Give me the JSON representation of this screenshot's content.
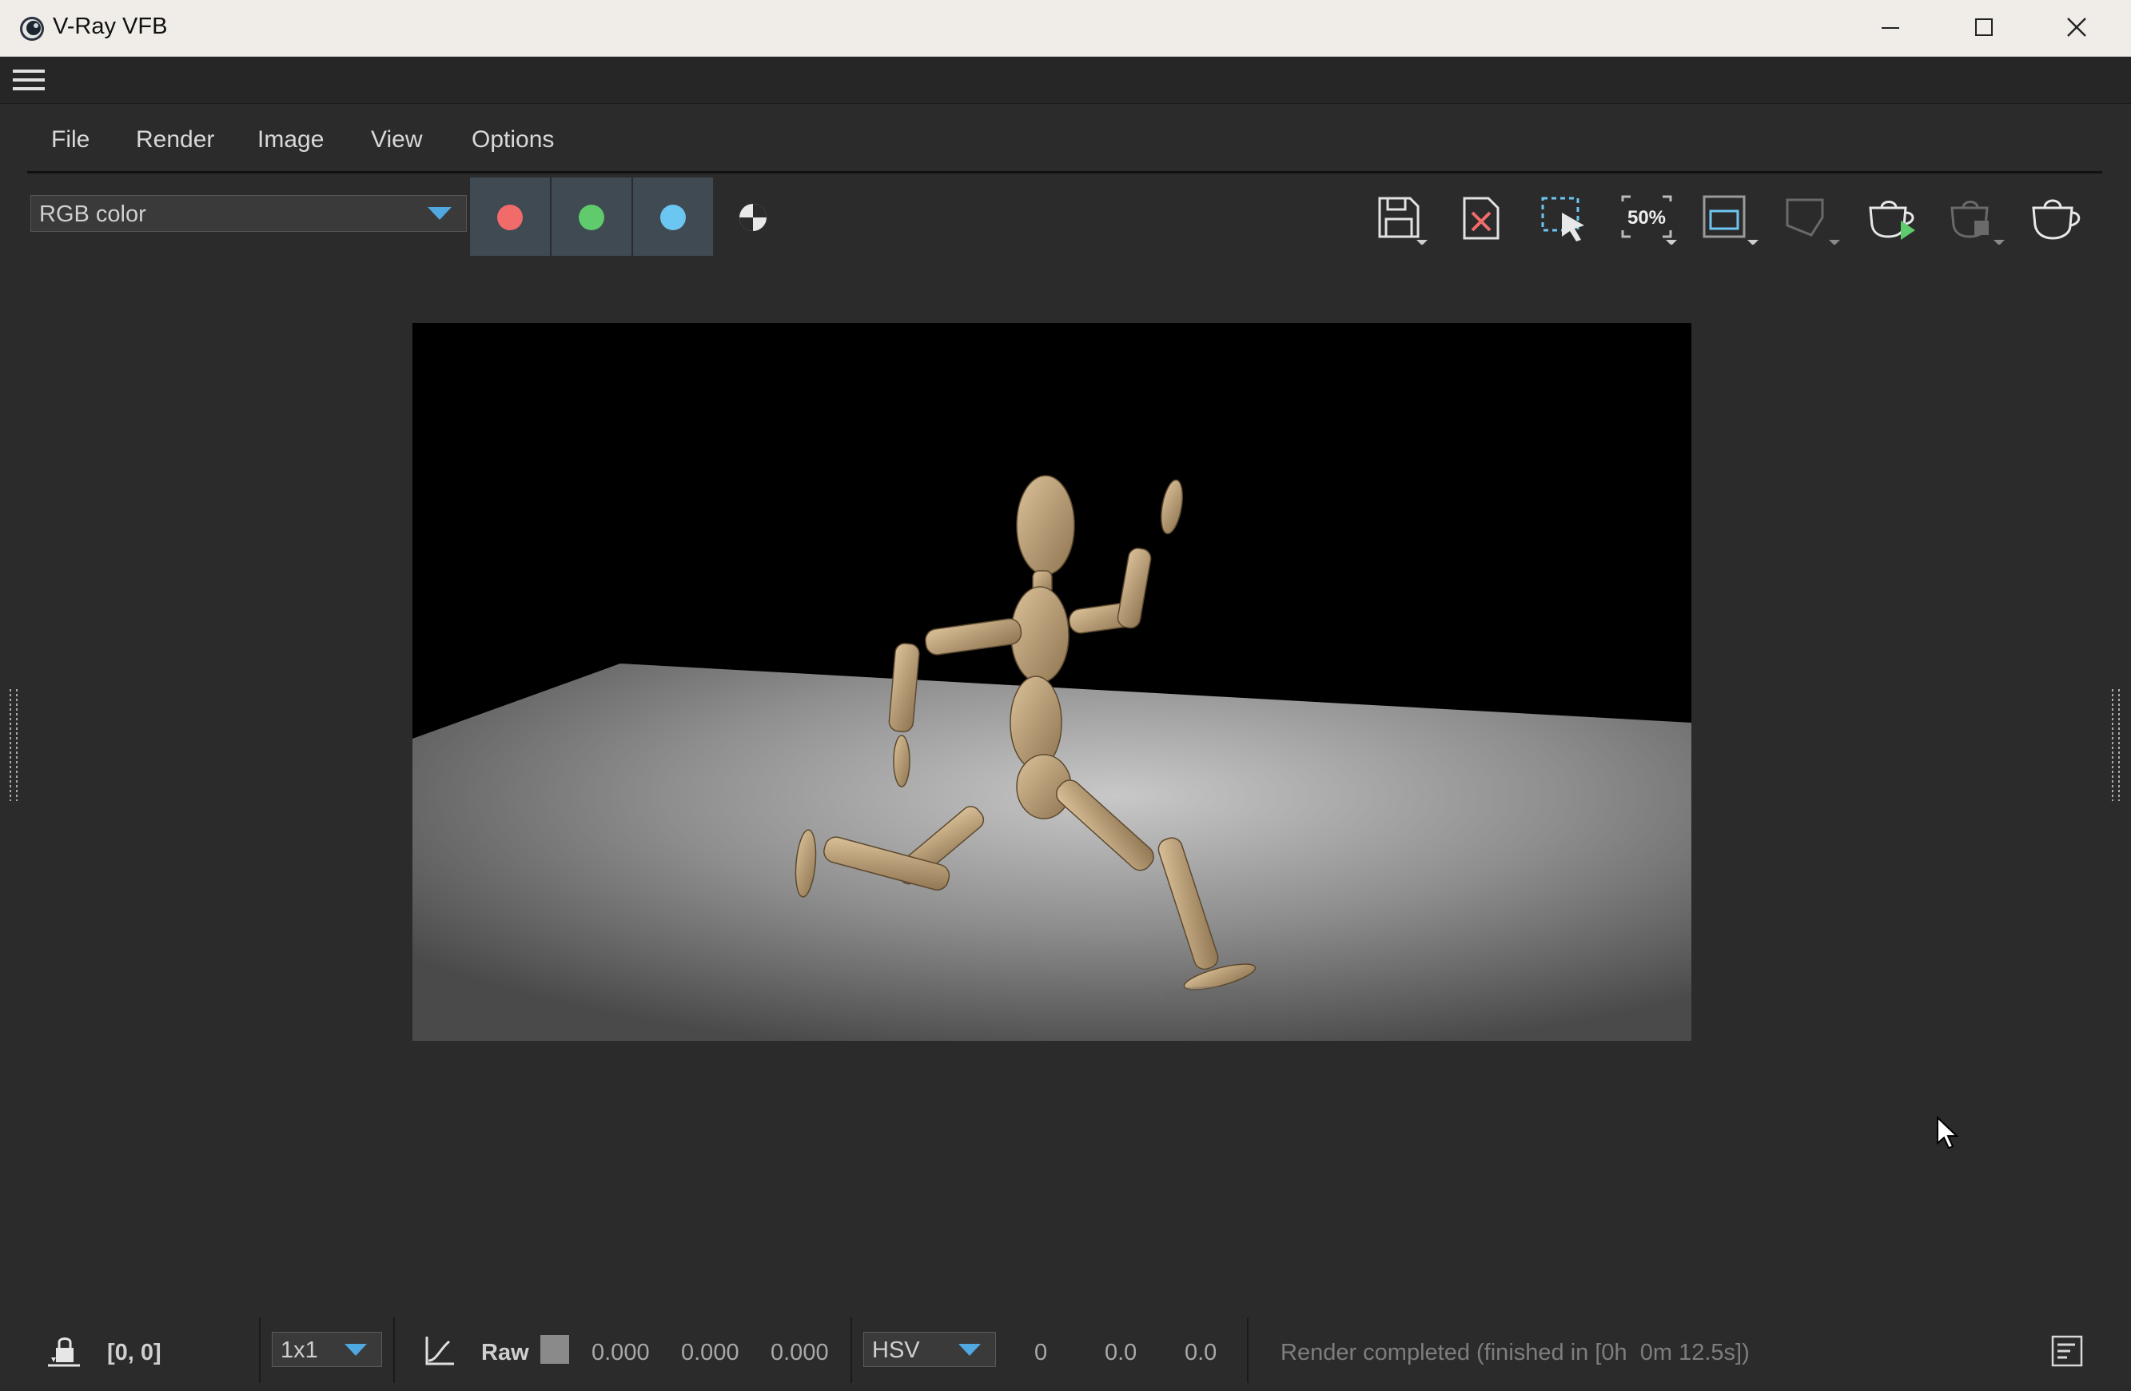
{
  "window": {
    "title": "V-Ray VFB",
    "minimize_icon": "minimize-icon",
    "maximize_icon": "maximize-icon",
    "close_icon": "close-icon"
  },
  "menu": [
    "File",
    "Render",
    "Image",
    "View",
    "Options"
  ],
  "toolbar": {
    "channel": "RGB color",
    "channel_buttons": [
      {
        "name": "red-channel",
        "color": "#f26b6b"
      },
      {
        "name": "green-channel",
        "color": "#5fcb6c"
      },
      {
        "name": "blue-channel",
        "color": "#6cc6f2"
      }
    ],
    "alpha_icon": "alpha-channel-icon",
    "zoom_label": "50%",
    "right_tools": [
      "save-image-icon",
      "clear-image-icon",
      "region-render-icon",
      "zoom-50-icon",
      "display-region-icon",
      "track-mouse-icon",
      "start-interactive-render-icon",
      "stop-render-icon",
      "render-icon"
    ]
  },
  "render": {
    "subject": "wooden artist mannequin running on a grey floor",
    "colors": {
      "background": "#000000",
      "floor": "#8a8a8a",
      "wood": "#b89a6a"
    }
  },
  "status": {
    "coords": "[0, 0]",
    "sampling": "1x1",
    "raw_label": "Raw",
    "rgb_values": [
      "0.000",
      "0.000",
      "0.000"
    ],
    "color_space": "HSV",
    "hsv_values": [
      "0",
      "0.0",
      "0.0"
    ],
    "message": "Render completed (finished in [0h  0m 12.5s])"
  }
}
